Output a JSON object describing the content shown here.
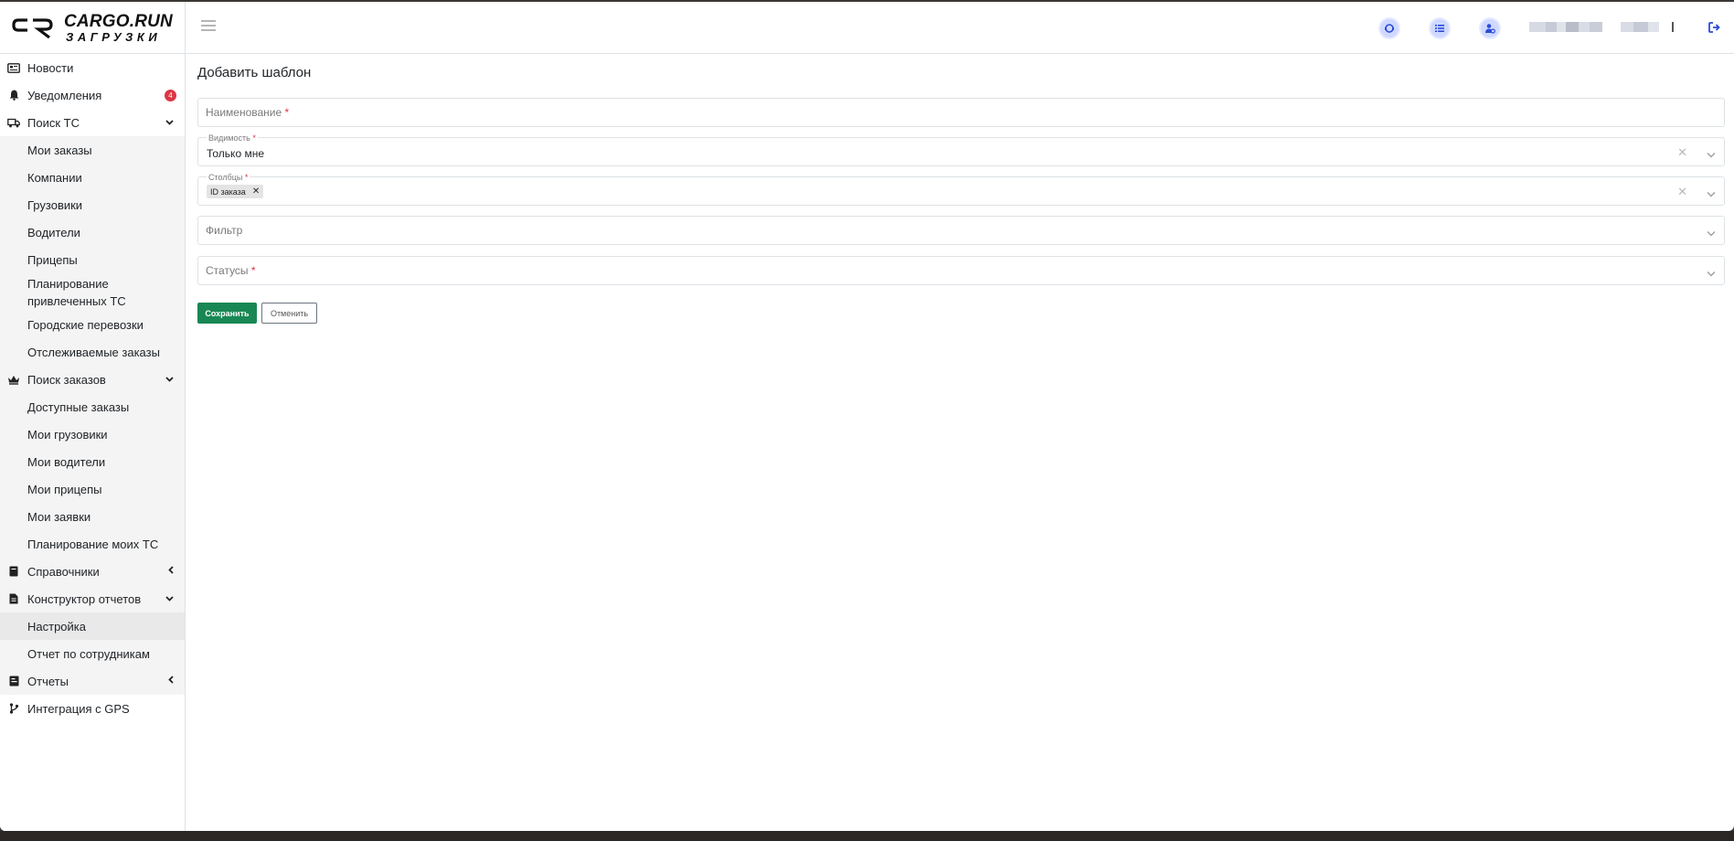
{
  "brand": {
    "name": "CARGO.RUN",
    "sub": "ЗАГРУЗКИ"
  },
  "topbar": {
    "icons": [
      "support-icon",
      "list-icon",
      "user-settings-icon",
      "logout-icon"
    ]
  },
  "sidebar": {
    "news": "Новости",
    "notifications": {
      "label": "Уведомления",
      "badge": "4"
    },
    "search_tc": {
      "label": "Поиск ТС",
      "items": [
        "Мои заказы",
        "Компании",
        "Грузовики",
        "Водители",
        "Прицепы",
        "Планирование привлеченных ТС",
        "Городские перевозки",
        "Отслеживаемые заказы"
      ]
    },
    "search_orders": {
      "label": "Поиск заказов",
      "items": [
        "Доступные заказы",
        "Мои грузовики",
        "Мои водители",
        "Мои прицепы",
        "Мои заявки",
        "Планирование моих ТС"
      ]
    },
    "references": "Справочники",
    "report_builder": {
      "label": "Конструктор отчетов",
      "items": [
        "Настройка",
        "Отчет по сотрудникам"
      ]
    },
    "reports": "Отчеты",
    "gps": "Интеграция с GPS"
  },
  "form": {
    "title": "Добавить шаблон",
    "name_placeholder": "Наименование",
    "visibility_label": "Видимость",
    "visibility_value": "Только мне",
    "columns_label": "Столбцы",
    "columns_tag": "ID заказа",
    "filter_placeholder": "Фильтр",
    "statuses_placeholder": "Статусы",
    "required_mark": "*",
    "save": "Сохранить",
    "cancel": "Отменить"
  },
  "colors": {
    "accent": "#2b4bd9",
    "save": "#198754",
    "badge": "#dc3545"
  }
}
